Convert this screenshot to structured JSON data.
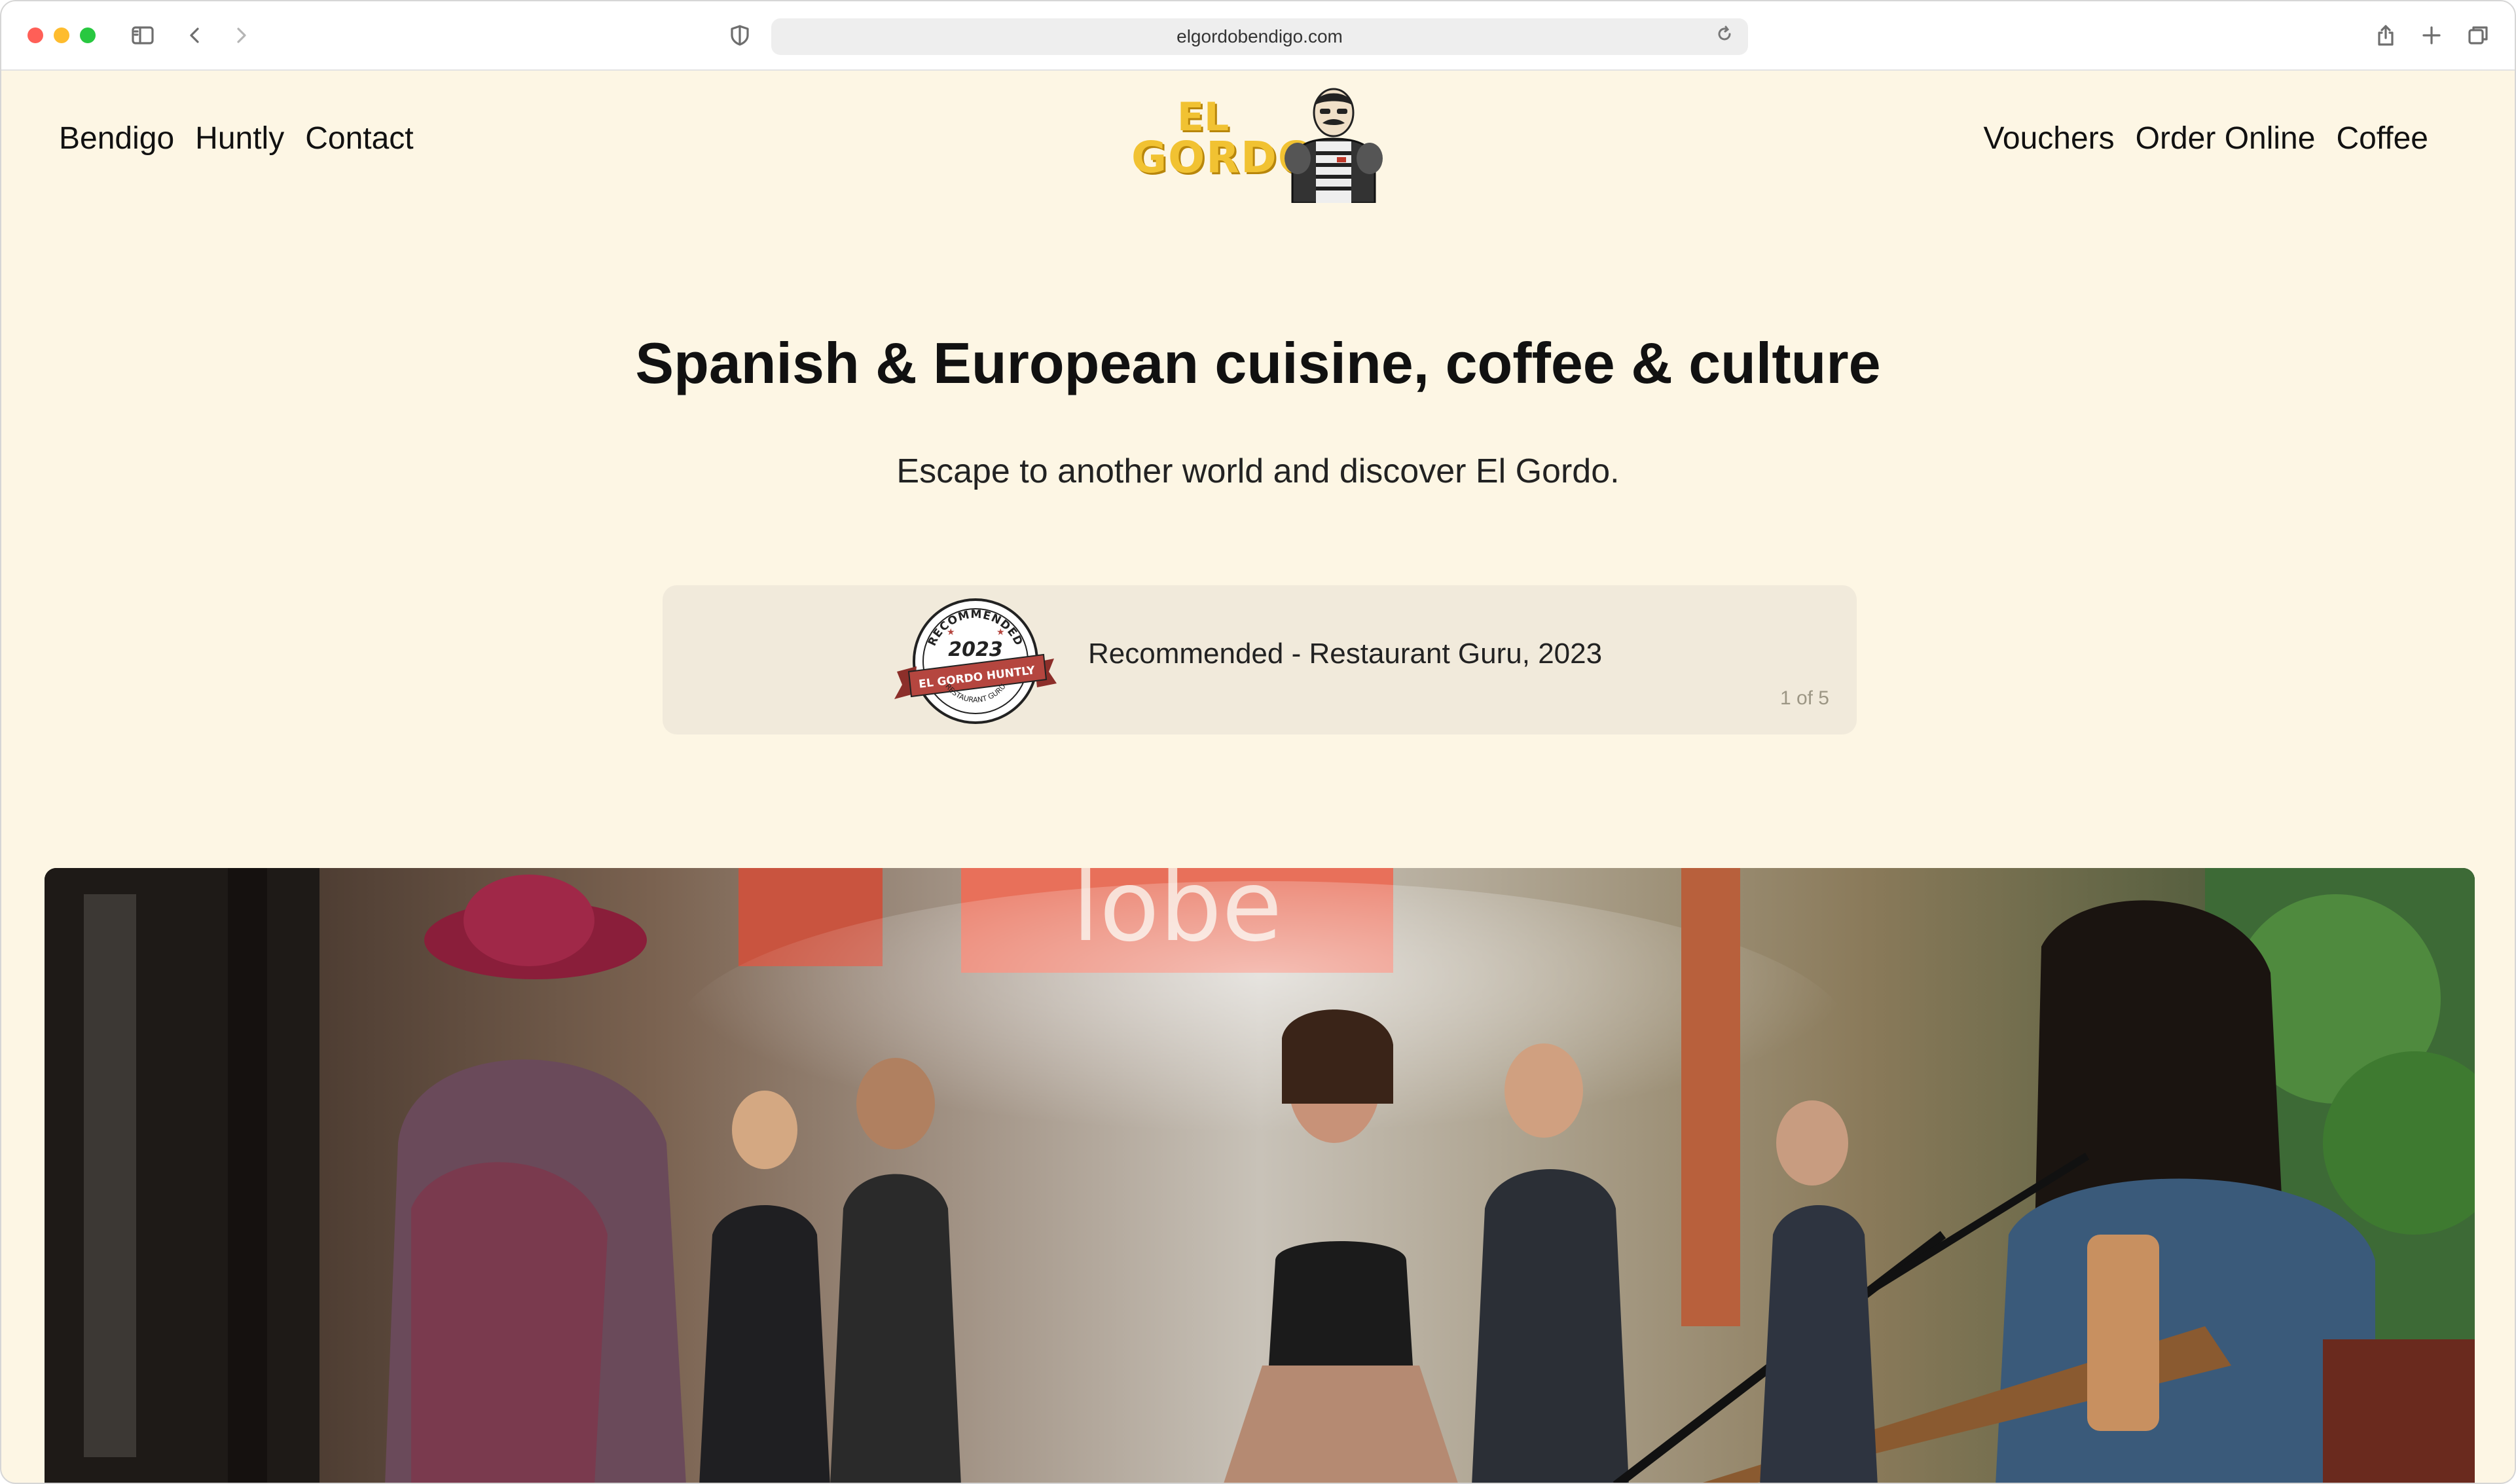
{
  "browser": {
    "url": "elgordobendigo.com",
    "icons": [
      "sidebar-icon",
      "back-icon",
      "forward-icon",
      "shield-icon",
      "reload-icon",
      "share-icon",
      "new-tab-icon",
      "tabs-overview-icon"
    ]
  },
  "nav": {
    "left": [
      "Bendigo",
      "Huntly",
      "Contact"
    ],
    "right": [
      "Vouchers",
      "Order Online",
      "Coffee"
    ]
  },
  "logo": {
    "line1": "EL",
    "line2": "GORDO"
  },
  "hero_text": {
    "headline": "Spanish & European cuisine, coffee & culture",
    "subline": "Escape to another world and discover El Gordo."
  },
  "carousel": {
    "text": "Recommended - Restaurant Guru, 2023",
    "count": "1 of 5",
    "badge": {
      "top": "RECOMMENDED",
      "year": "2023",
      "ribbon": "EL GORDO HUNTLY",
      "bottom": "RESTAURANT GURU"
    }
  },
  "hero_image": {
    "sign_text": "lobe"
  },
  "colors": {
    "page_bg": "#fdf6e4",
    "card_bg": "#f1eadb",
    "logo_yellow": "#f1c232",
    "badge_red": "#b5463f"
  }
}
